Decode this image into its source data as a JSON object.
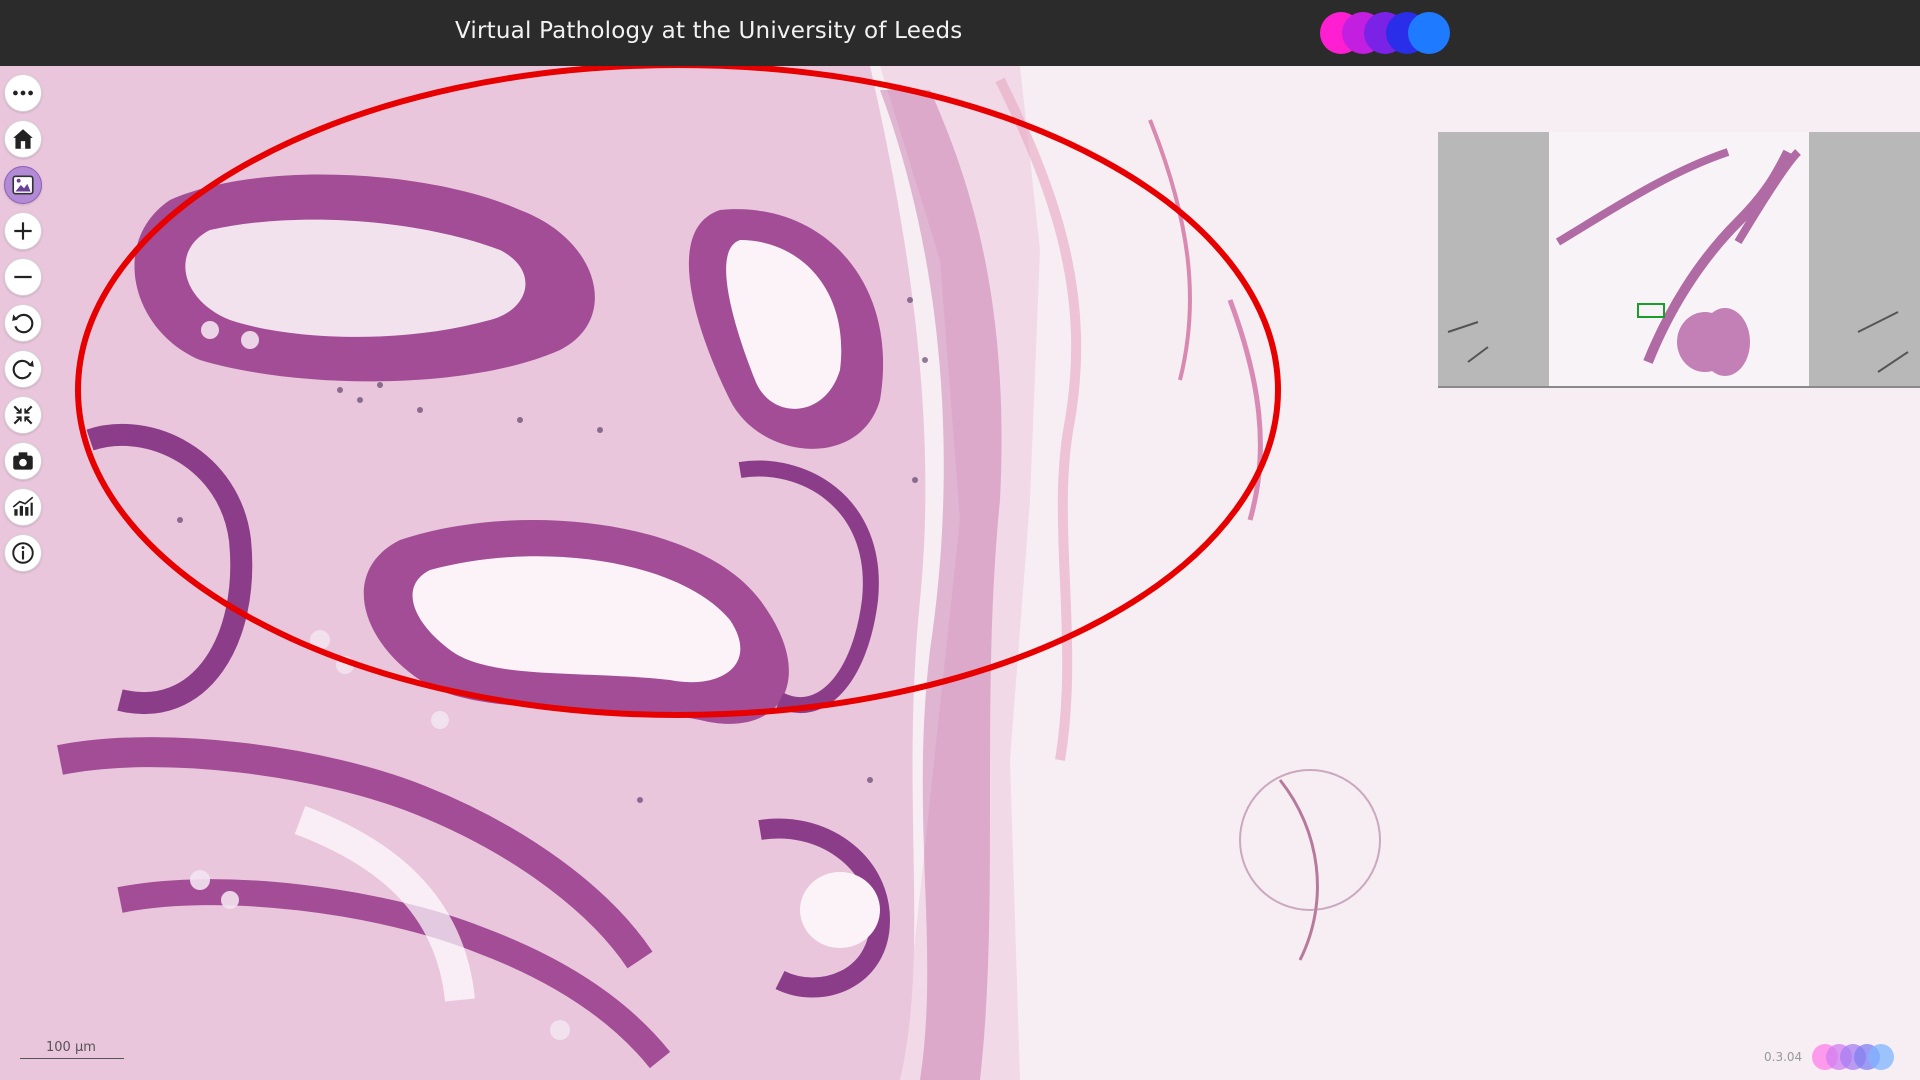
{
  "header": {
    "title": "Virtual Pathology at the University of Leeds",
    "logo_colors": [
      "#ff1fd2",
      "#c21fe0",
      "#7a22e6",
      "#2a2ee8",
      "#1e7bff"
    ]
  },
  "toolbar": {
    "items": [
      {
        "name": "more",
        "icon": "more-icon",
        "active": false
      },
      {
        "name": "home",
        "icon": "home-icon",
        "active": false
      },
      {
        "name": "image",
        "icon": "image-icon",
        "active": true
      },
      {
        "name": "zoom-in",
        "icon": "plus-icon",
        "active": false
      },
      {
        "name": "zoom-out",
        "icon": "minus-icon",
        "active": false
      },
      {
        "name": "rotate-left",
        "icon": "rotate-left-icon",
        "active": false
      },
      {
        "name": "rotate-right",
        "icon": "rotate-right-icon",
        "active": false
      },
      {
        "name": "fit",
        "icon": "collapse-icon",
        "active": false
      },
      {
        "name": "screenshot",
        "icon": "camera-icon",
        "active": false
      },
      {
        "name": "adjust",
        "icon": "chart-icon",
        "active": false
      },
      {
        "name": "info",
        "icon": "info-icon",
        "active": false
      }
    ]
  },
  "viewer": {
    "annotation_color": "#e60000",
    "stain_colors": [
      "#8b3d8a",
      "#b85fa8",
      "#e8bde0",
      "#d66b8c"
    ]
  },
  "scale_bar": {
    "label": "100 µm"
  },
  "footer": {
    "version": "0.3.04",
    "logo_colors": [
      "#ff7de8",
      "#d07df0",
      "#a77df2",
      "#7f80f2",
      "#7fb4ff"
    ]
  }
}
